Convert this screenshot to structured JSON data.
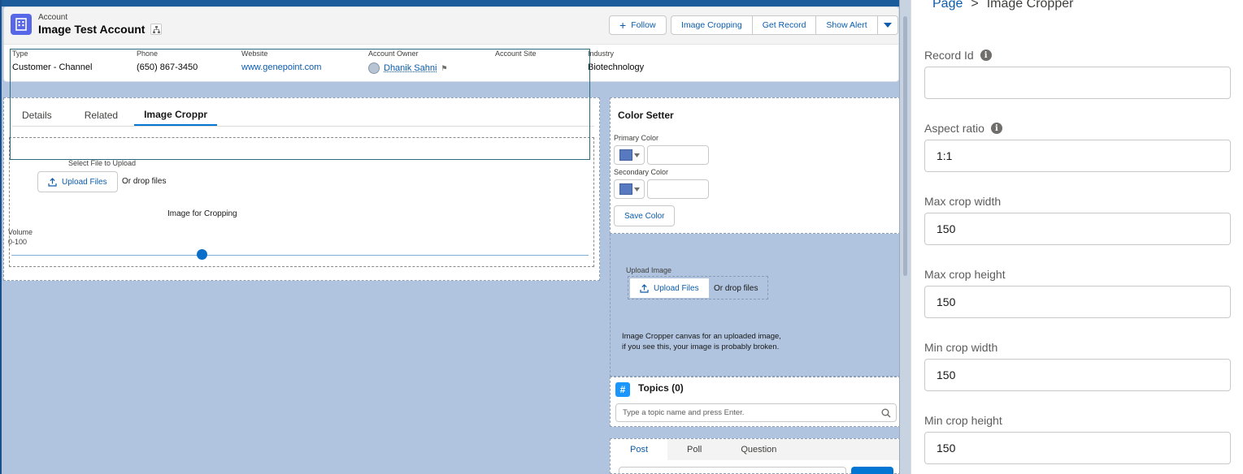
{
  "header": {
    "object_label": "Account",
    "record_title": "Image Test Account",
    "actions": {
      "follow": "Follow",
      "image_cropping": "Image Cropping",
      "get_record": "Get Record",
      "show_alert": "Show Alert"
    },
    "highlights": [
      {
        "label": "Type",
        "value": "Customer - Channel"
      },
      {
        "label": "Phone",
        "value": "(650) 867-3450"
      },
      {
        "label": "Website",
        "value": "www.genepoint.com"
      },
      {
        "label": "Account Owner",
        "value": "Dhanik Sahni"
      },
      {
        "label": "Account Site",
        "value": ""
      },
      {
        "label": "Industry",
        "value": "Biotechnology"
      }
    ]
  },
  "tabs": [
    "Details",
    "Related",
    "Image Croppr"
  ],
  "cropper": {
    "select_label": "Select File to Upload",
    "upload_label": "Upload Files",
    "drop_label": "Or drop files",
    "image_label": "Image for Cropping",
    "volume_label": "Volume",
    "volume_range": "0-100",
    "volume_value": 33
  },
  "color_setter": {
    "title": "Color Setter",
    "primary_label": "Primary Color",
    "secondary_label": "Secondary Color",
    "save_label": "Save Color",
    "swatch_color": "#5679c0"
  },
  "upload_image": {
    "label": "Upload Image",
    "upload_label": "Upload Files",
    "drop_label": "Or drop files",
    "broken_line1": "Image Cropper canvas for an uploaded image,",
    "broken_line2": "if you see this, your image is probably broken."
  },
  "topics": {
    "title": "Topics (0)",
    "placeholder": "Type a topic name and press Enter."
  },
  "publisher": {
    "tabs": [
      "Post",
      "Poll",
      "Question"
    ]
  },
  "panel": {
    "breadcrumb_root": "Page",
    "breadcrumb_sep": ">",
    "breadcrumb_current": "Image Cropper",
    "fields": [
      {
        "label": "Record Id",
        "value": "",
        "info": true
      },
      {
        "label": "Aspect ratio",
        "value": "1:1",
        "info": true
      },
      {
        "label": "Max crop width",
        "value": "150",
        "info": false
      },
      {
        "label": "Max crop height",
        "value": "150",
        "info": false
      },
      {
        "label": "Min crop width",
        "value": "150",
        "info": false
      },
      {
        "label": "Min crop height",
        "value": "150",
        "info": false
      }
    ]
  }
}
